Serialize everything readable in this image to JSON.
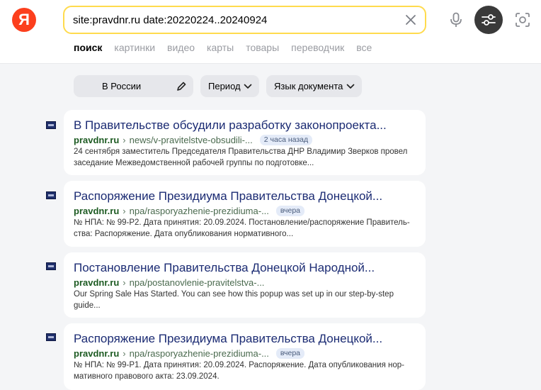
{
  "header": {
    "logo_letter": "Я",
    "search_query": "site:pravdnr.ru date:20220224..20240924"
  },
  "nav": {
    "tabs": [
      {
        "label": "поиск",
        "active": true
      },
      {
        "label": "картинки",
        "active": false
      },
      {
        "label": "видео",
        "active": false
      },
      {
        "label": "карты",
        "active": false
      },
      {
        "label": "товары",
        "active": false
      },
      {
        "label": "переводчик",
        "active": false
      },
      {
        "label": "все",
        "active": false
      }
    ]
  },
  "filters": {
    "region": "В России",
    "period": "Период",
    "language": "Язык документа"
  },
  "results": [
    {
      "title": "В Правительстве обсудили разработку законопроекта...",
      "domain": "pravdnr.ru",
      "path": "news/v-pravitelstve-obsudili-...",
      "badge": "2 часа назад",
      "snippet": "24 сентября заместитель Председателя Правительства ДНР Владимир Зверков провел заседание Межведомственной рабочей группы по подготовке..."
    },
    {
      "title": "Распоряжение Президиума Правительства Донецкой...",
      "domain": "pravdnr.ru",
      "path": "npa/rasporyazhenie-prezidiuma-...",
      "badge": "вчера",
      "snippet": "№ НПА: № 99-Р2. Дата принятия: 20.09.2024. Постановление/распоряжение Правитель-ства: Распоряжение. Дата опубликования нормативного..."
    },
    {
      "title": "Постановление Правительства Донецкой Народной...",
      "domain": "pravdnr.ru",
      "path": "npa/postanovlenie-pravitelstva-...",
      "badge": "",
      "snippet": "Our Spring Sale Has Started. You can see how this popup was set up in our step-by-step guide..."
    },
    {
      "title": "Распоряжение Президиума Правительства Донецкой...",
      "domain": "pravdnr.ru",
      "path": "npa/rasporyazhenie-prezidiuma-...",
      "badge": "вчера",
      "snippet": "№ НПА: № 99-Р1. Дата принятия: 20.09.2024. Распоряжение. Дата опубликования нор-мативного правового акта: 23.09.2024."
    }
  ],
  "colors": {
    "logo": "#fc3f1d",
    "search_border": "#ffdb4d",
    "title_link": "#1b2b73",
    "url_green": "#1d5b22"
  }
}
